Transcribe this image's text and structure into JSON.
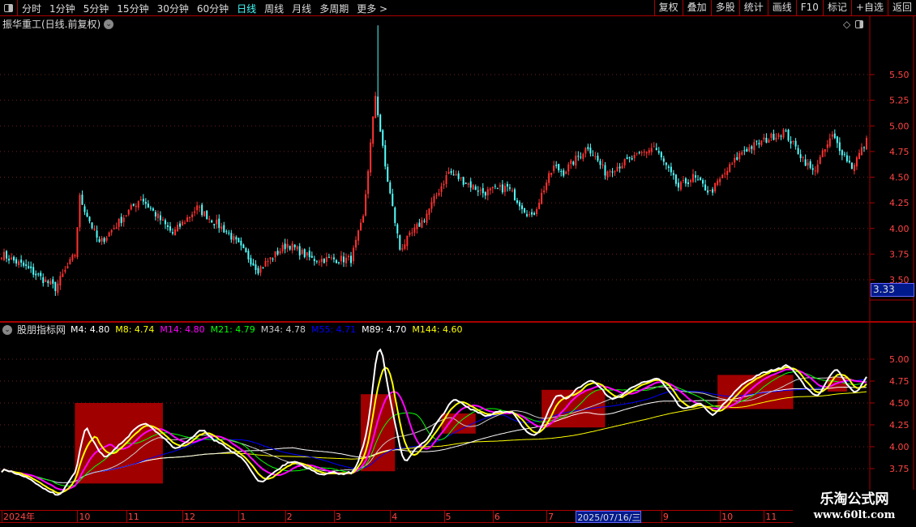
{
  "toolbar": {
    "periods": [
      "分时",
      "1分钟",
      "5分钟",
      "15分钟",
      "30分钟",
      "60分钟",
      "日线",
      "周线",
      "月线",
      "多周期",
      "更多 >"
    ],
    "active": "日线",
    "actions": [
      "复权",
      "叠加",
      "多股",
      "统计",
      "画线",
      "F10",
      "标记",
      "+自选",
      "返回"
    ]
  },
  "stock_title": "振华重工(日线.前复权)",
  "current_price_tag": "3.33",
  "indicator": {
    "name": "股朋指标网",
    "values": [
      {
        "label": "M4: 4.80",
        "color": "#ffffff"
      },
      {
        "label": "M8: 4.74",
        "color": "#ffff00"
      },
      {
        "label": "M14: 4.80",
        "color": "#ff00ff"
      },
      {
        "label": "M21: 4.79",
        "color": "#00ff00"
      },
      {
        "label": "M34: 4.78",
        "color": "#cccccc"
      },
      {
        "label": "M55: 4.71",
        "color": "#0000ff"
      },
      {
        "label": "M89: 4.70",
        "color": "#ffffff"
      },
      {
        "label": "M144: 4.60",
        "color": "#ffff00"
      }
    ]
  },
  "watermark": {
    "name": "乐淘公式网",
    "url": "www.60lt.com"
  },
  "chart_data": [
    {
      "type": "candlestick",
      "title": "振华重工(日线.前复权)",
      "yticks": [
        3.5,
        3.75,
        4.0,
        4.25,
        4.5,
        4.75,
        5.0,
        5.25,
        5.5
      ],
      "ylim": [
        3.33,
        6.05
      ],
      "up_color": "#ff3232",
      "down_color": "#54ffff",
      "n": 355,
      "close_keypoints": [
        [
          0,
          3.75
        ],
        [
          10,
          3.62
        ],
        [
          22,
          3.42
        ],
        [
          30,
          3.75
        ],
        [
          32,
          4.3
        ],
        [
          40,
          3.85
        ],
        [
          57,
          4.3
        ],
        [
          70,
          3.95
        ],
        [
          80,
          4.2
        ],
        [
          93,
          3.95
        ],
        [
          105,
          3.6
        ],
        [
          117,
          3.85
        ],
        [
          127,
          3.7
        ],
        [
          143,
          3.7
        ],
        [
          148,
          4.1
        ],
        [
          153,
          5.3
        ],
        [
          157,
          4.6
        ],
        [
          163,
          3.8
        ],
        [
          173,
          4.1
        ],
        [
          183,
          4.55
        ],
        [
          197,
          4.35
        ],
        [
          207,
          4.4
        ],
        [
          217,
          4.1
        ],
        [
          223,
          4.45
        ],
        [
          226,
          4.6
        ],
        [
          230,
          4.55
        ],
        [
          240,
          4.8
        ],
        [
          247,
          4.55
        ],
        [
          260,
          4.7
        ],
        [
          267,
          4.8
        ],
        [
          277,
          4.4
        ],
        [
          283,
          4.5
        ],
        [
          290,
          4.35
        ],
        [
          303,
          4.75
        ],
        [
          320,
          4.95
        ],
        [
          332,
          4.55
        ],
        [
          340,
          4.9
        ],
        [
          348,
          4.6
        ],
        [
          354,
          4.85
        ]
      ],
      "spike": {
        "index": 154,
        "high": 5.98
      }
    },
    {
      "type": "line",
      "title": "股朋指标网",
      "yticks": [
        3.75,
        4.0,
        4.25,
        4.5,
        4.75,
        5.0
      ],
      "ylim": [
        3.45,
        5.25
      ],
      "series": [
        {
          "name": "M4",
          "period": 4,
          "color": "#ffffff"
        },
        {
          "name": "M8",
          "period": 8,
          "color": "#ffff00"
        },
        {
          "name": "M14",
          "period": 14,
          "color": "#ff00ff"
        },
        {
          "name": "M21",
          "period": 21,
          "color": "#00ff00"
        },
        {
          "name": "M34",
          "period": 34,
          "color": "#cccccc"
        },
        {
          "name": "M55",
          "period": 55,
          "color": "#0000ff"
        },
        {
          "name": "M89",
          "period": 89,
          "color": "#ffffff"
        },
        {
          "name": "M144",
          "period": 144,
          "color": "#ffff00"
        }
      ],
      "blocks": [
        [
          30,
          66,
          3.58,
          4.5
        ],
        [
          147,
          161,
          3.72,
          4.6
        ],
        [
          180,
          194,
          4.15,
          4.38
        ],
        [
          221,
          247,
          4.22,
          4.65
        ],
        [
          293,
          324,
          4.43,
          4.82
        ],
        [
          338,
          346,
          4.63,
          4.8
        ]
      ],
      "block_color": "#a00000"
    }
  ],
  "date_axis": [
    {
      "label": "2024年",
      "i": 0
    },
    {
      "label": "10",
      "i": 31
    },
    {
      "label": "11",
      "i": 51
    },
    {
      "label": "12",
      "i": 74
    },
    {
      "label": "1",
      "i": 97
    },
    {
      "label": "2",
      "i": 116
    },
    {
      "label": "3",
      "i": 136
    },
    {
      "label": "4",
      "i": 159
    },
    {
      "label": "5",
      "i": 181
    },
    {
      "label": "6",
      "i": 201
    },
    {
      "label": "7",
      "i": 223
    },
    {
      "label": "2025/07/16/三",
      "i": 235,
      "highlight": true
    },
    {
      "label": "9",
      "i": 270
    },
    {
      "label": "10",
      "i": 294
    },
    {
      "label": "11",
      "i": 312
    }
  ]
}
